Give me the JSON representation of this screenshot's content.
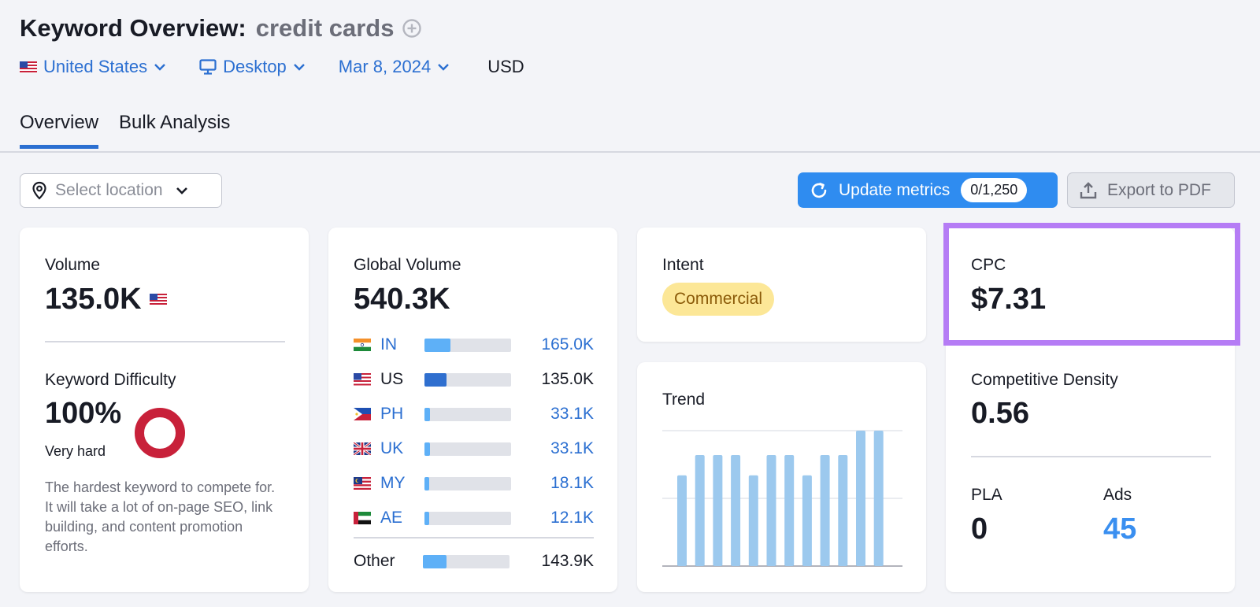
{
  "header": {
    "title": "Keyword Overview:",
    "keyword": "credit cards",
    "country": "United States",
    "device": "Desktop",
    "date": "Mar 8, 2024",
    "currency": "USD"
  },
  "tabs": [
    {
      "label": "Overview",
      "active": true
    },
    {
      "label": "Bulk Analysis",
      "active": false
    }
  ],
  "toolbar": {
    "location_placeholder": "Select location",
    "update_label": "Update metrics",
    "update_count": "0/1,250",
    "export_label": "Export to PDF"
  },
  "volume": {
    "label": "Volume",
    "value": "135.0K"
  },
  "difficulty": {
    "label": "Keyword Difficulty",
    "value": "100%",
    "level": "Very hard",
    "percent": 100,
    "description": "The hardest keyword to compete for. It will take a lot of on-page SEO, link building, and content promotion efforts."
  },
  "global_volume": {
    "label": "Global Volume",
    "value": "540.3K",
    "countries": [
      {
        "code": "IN",
        "value": "165.0K",
        "share": 0.3,
        "link": true
      },
      {
        "code": "US",
        "value": "135.0K",
        "share": 0.25,
        "link": false
      },
      {
        "code": "PH",
        "value": "33.1K",
        "share": 0.06,
        "link": true
      },
      {
        "code": "UK",
        "value": "33.1K",
        "share": 0.06,
        "link": true
      },
      {
        "code": "MY",
        "value": "18.1K",
        "share": 0.04,
        "link": true
      },
      {
        "code": "AE",
        "value": "12.1K",
        "share": 0.03,
        "link": true
      }
    ],
    "other": {
      "label": "Other",
      "value": "143.9K",
      "share": 0.27
    }
  },
  "intent": {
    "label": "Intent",
    "value": "Commercial"
  },
  "trend": {
    "label": "Trend",
    "values": [
      0.67,
      0.82,
      0.82,
      0.82,
      0.67,
      0.82,
      0.82,
      0.67,
      0.82,
      0.82,
      1.0,
      1.0
    ]
  },
  "cpc": {
    "label": "CPC",
    "value": "$7.31"
  },
  "competitive_density": {
    "label": "Competitive Density",
    "value": "0.56"
  },
  "pla": {
    "label": "PLA",
    "value": "0"
  },
  "ads": {
    "label": "Ads",
    "value": "45"
  },
  "colors": {
    "accent": "#2f8cf0",
    "link": "#2b6fd1",
    "highlight": "#b57cf5",
    "difficulty": "#c8213a",
    "intent_bg": "#fce797",
    "trend_bar": "#9cc9ee"
  }
}
